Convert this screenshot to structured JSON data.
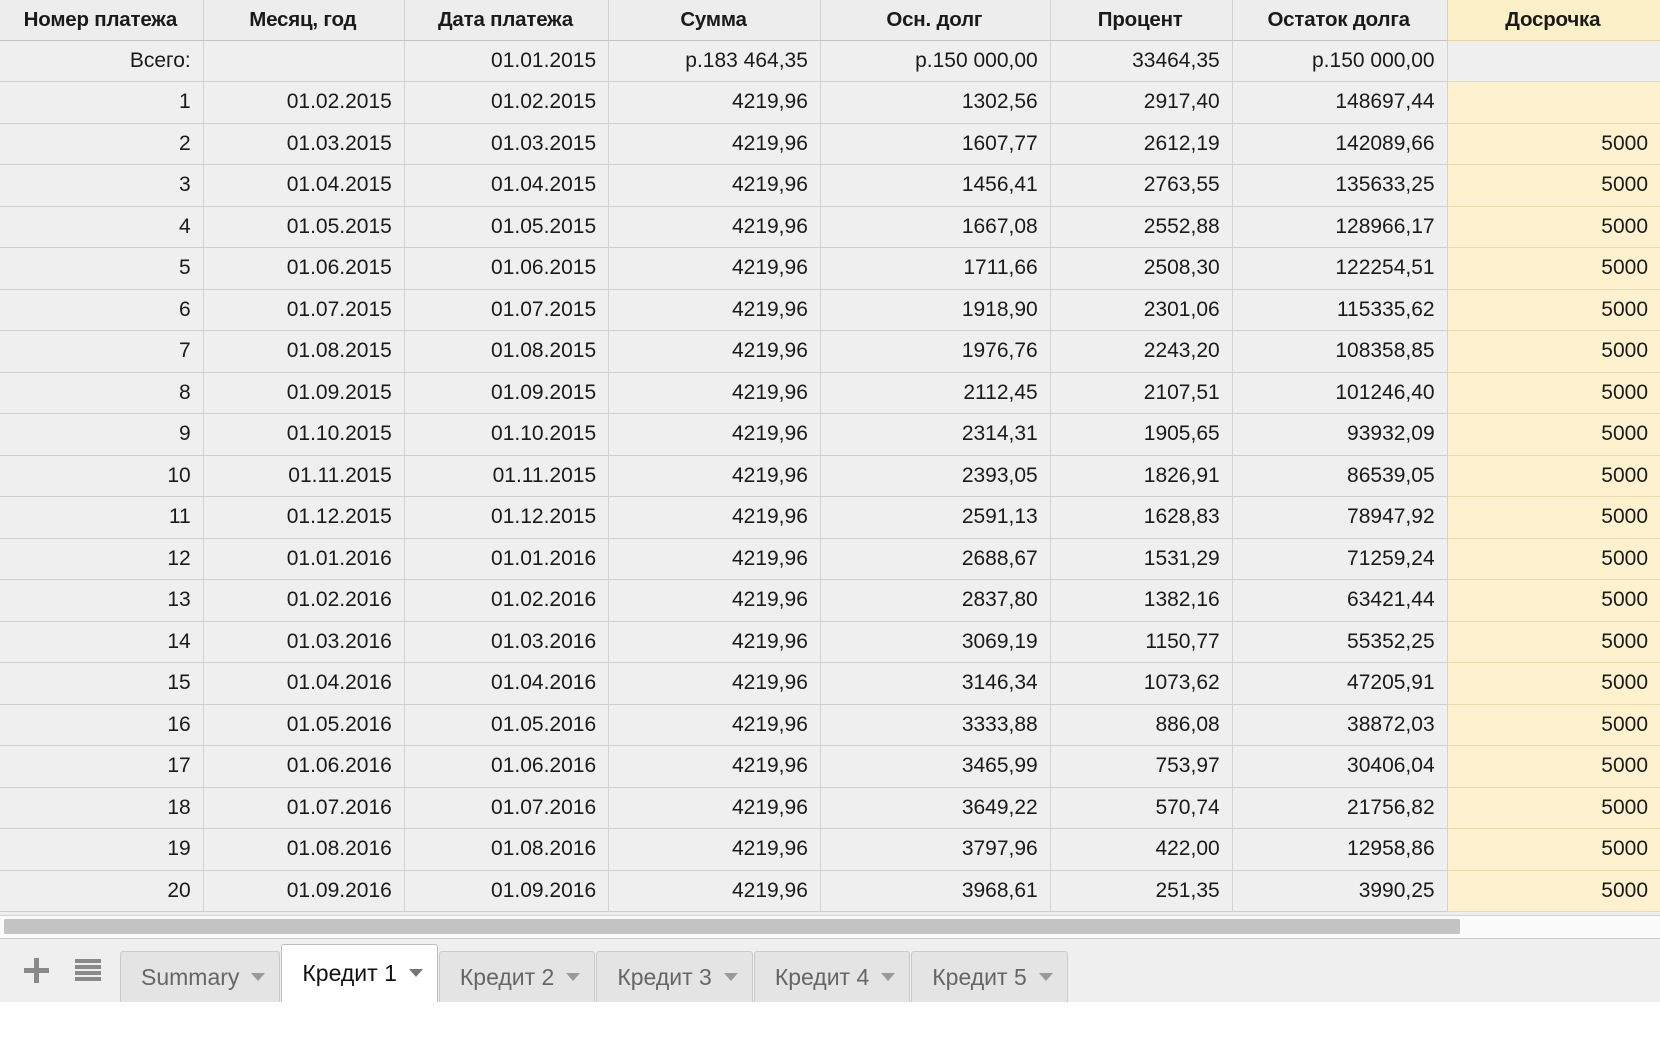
{
  "table": {
    "columns": [
      {
        "key": "num",
        "label": "Номер платежа"
      },
      {
        "key": "month",
        "label": "Месяц, год"
      },
      {
        "key": "date",
        "label": "Дата платежа"
      },
      {
        "key": "sum",
        "label": "Сумма"
      },
      {
        "key": "prin",
        "label": "Осн. долг"
      },
      {
        "key": "int",
        "label": "Процент"
      },
      {
        "key": "rest",
        "label": "Остаток долга"
      },
      {
        "key": "early",
        "label": "Досрочка"
      }
    ],
    "rows": [
      {
        "num": "Всего:",
        "month": "",
        "date": "01.01.2015",
        "sum": "р.183 464,35",
        "prin": "р.150 000,00",
        "int": "33464,35",
        "rest": "р.150 000,00",
        "early": ""
      },
      {
        "num": "1",
        "month": "01.02.2015",
        "date": "01.02.2015",
        "sum": "4219,96",
        "prin": "1302,56",
        "int": "2917,40",
        "rest": "148697,44",
        "early": ""
      },
      {
        "num": "2",
        "month": "01.03.2015",
        "date": "01.03.2015",
        "sum": "4219,96",
        "prin": "1607,77",
        "int": "2612,19",
        "rest": "142089,66",
        "early": "5000"
      },
      {
        "num": "3",
        "month": "01.04.2015",
        "date": "01.04.2015",
        "sum": "4219,96",
        "prin": "1456,41",
        "int": "2763,55",
        "rest": "135633,25",
        "early": "5000"
      },
      {
        "num": "4",
        "month": "01.05.2015",
        "date": "01.05.2015",
        "sum": "4219,96",
        "prin": "1667,08",
        "int": "2552,88",
        "rest": "128966,17",
        "early": "5000"
      },
      {
        "num": "5",
        "month": "01.06.2015",
        "date": "01.06.2015",
        "sum": "4219,96",
        "prin": "1711,66",
        "int": "2508,30",
        "rest": "122254,51",
        "early": "5000"
      },
      {
        "num": "6",
        "month": "01.07.2015",
        "date": "01.07.2015",
        "sum": "4219,96",
        "prin": "1918,90",
        "int": "2301,06",
        "rest": "115335,62",
        "early": "5000"
      },
      {
        "num": "7",
        "month": "01.08.2015",
        "date": "01.08.2015",
        "sum": "4219,96",
        "prin": "1976,76",
        "int": "2243,20",
        "rest": "108358,85",
        "early": "5000"
      },
      {
        "num": "8",
        "month": "01.09.2015",
        "date": "01.09.2015",
        "sum": "4219,96",
        "prin": "2112,45",
        "int": "2107,51",
        "rest": "101246,40",
        "early": "5000"
      },
      {
        "num": "9",
        "month": "01.10.2015",
        "date": "01.10.2015",
        "sum": "4219,96",
        "prin": "2314,31",
        "int": "1905,65",
        "rest": "93932,09",
        "early": "5000"
      },
      {
        "num": "10",
        "month": "01.11.2015",
        "date": "01.11.2015",
        "sum": "4219,96",
        "prin": "2393,05",
        "int": "1826,91",
        "rest": "86539,05",
        "early": "5000"
      },
      {
        "num": "11",
        "month": "01.12.2015",
        "date": "01.12.2015",
        "sum": "4219,96",
        "prin": "2591,13",
        "int": "1628,83",
        "rest": "78947,92",
        "early": "5000"
      },
      {
        "num": "12",
        "month": "01.01.2016",
        "date": "01.01.2016",
        "sum": "4219,96",
        "prin": "2688,67",
        "int": "1531,29",
        "rest": "71259,24",
        "early": "5000"
      },
      {
        "num": "13",
        "month": "01.02.2016",
        "date": "01.02.2016",
        "sum": "4219,96",
        "prin": "2837,80",
        "int": "1382,16",
        "rest": "63421,44",
        "early": "5000"
      },
      {
        "num": "14",
        "month": "01.03.2016",
        "date": "01.03.2016",
        "sum": "4219,96",
        "prin": "3069,19",
        "int": "1150,77",
        "rest": "55352,25",
        "early": "5000"
      },
      {
        "num": "15",
        "month": "01.04.2016",
        "date": "01.04.2016",
        "sum": "4219,96",
        "prin": "3146,34",
        "int": "1073,62",
        "rest": "47205,91",
        "early": "5000"
      },
      {
        "num": "16",
        "month": "01.05.2016",
        "date": "01.05.2016",
        "sum": "4219,96",
        "prin": "3333,88",
        "int": "886,08",
        "rest": "38872,03",
        "early": "5000"
      },
      {
        "num": "17",
        "month": "01.06.2016",
        "date": "01.06.2016",
        "sum": "4219,96",
        "prin": "3465,99",
        "int": "753,97",
        "rest": "30406,04",
        "early": "5000"
      },
      {
        "num": "18",
        "month": "01.07.2016",
        "date": "01.07.2016",
        "sum": "4219,96",
        "prin": "3649,22",
        "int": "570,74",
        "rest": "21756,82",
        "early": "5000"
      },
      {
        "num": "19",
        "month": "01.08.2016",
        "date": "01.08.2016",
        "sum": "4219,96",
        "prin": "3797,96",
        "int": "422,00",
        "rest": "12958,86",
        "early": "5000"
      },
      {
        "num": "20",
        "month": "01.09.2016",
        "date": "01.09.2016",
        "sum": "4219,96",
        "prin": "3968,61",
        "int": "251,35",
        "rest": "3990,25",
        "early": "5000"
      }
    ]
  },
  "tabbar": {
    "add_sheet_icon": "plus-icon",
    "all_sheets_icon": "list-icon",
    "tabs": [
      {
        "label": "Summary",
        "active": false
      },
      {
        "label": "Кредит 1",
        "active": true
      },
      {
        "label": "Кредит 2",
        "active": false
      },
      {
        "label": "Кредит 3",
        "active": false
      },
      {
        "label": "Кредит 4",
        "active": false
      },
      {
        "label": "Кредит 5",
        "active": false
      }
    ]
  },
  "colors": {
    "grid_bg": "#efefef",
    "header_bg": "#ededed",
    "highlight_column": "#fdf2cd",
    "gridline": "#d0d0d0",
    "active_tab_bg": "#ffffff"
  }
}
